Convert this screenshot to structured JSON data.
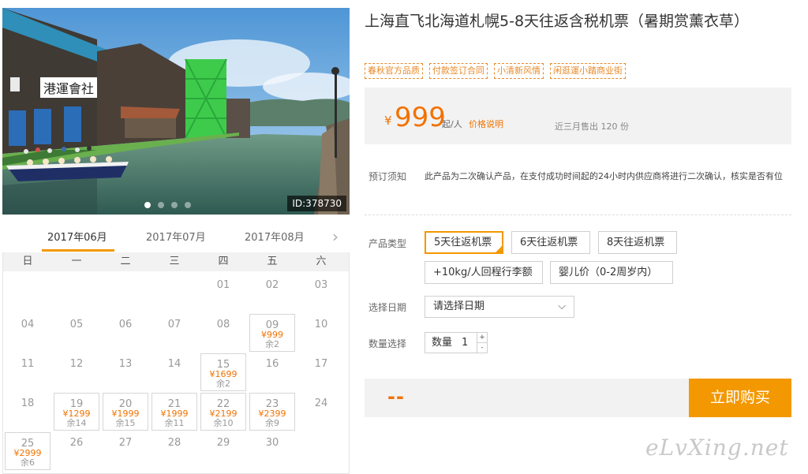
{
  "photo": {
    "id_badge": "ID:378730",
    "sign_text": "港運會社",
    "slide_count": 4,
    "active_slide": 1
  },
  "calendar": {
    "months": [
      "2017年06月",
      "2017年07月",
      "2017年08月"
    ],
    "active_month": "2017年06月",
    "next_icon": "chevron-right-icon",
    "weekdays": [
      "日",
      "一",
      "二",
      "三",
      "四",
      "五",
      "六"
    ],
    "days": [
      {
        "d": "01"
      },
      {
        "d": "02"
      },
      {
        "d": "03"
      },
      {
        "d": "04"
      },
      {
        "d": "05"
      },
      {
        "d": "06"
      },
      {
        "d": "07"
      },
      {
        "d": "08"
      },
      {
        "d": "09",
        "price": "¥999",
        "remain": "余2"
      },
      {
        "d": "10"
      },
      {
        "d": "11"
      },
      {
        "d": "12"
      },
      {
        "d": "13"
      },
      {
        "d": "14"
      },
      {
        "d": "15",
        "price": "¥1699",
        "remain": "余2"
      },
      {
        "d": "16"
      },
      {
        "d": "17"
      },
      {
        "d": "18"
      },
      {
        "d": "19",
        "price": "¥1299",
        "remain": "余14"
      },
      {
        "d": "20",
        "price": "¥1999",
        "remain": "余15"
      },
      {
        "d": "21",
        "price": "¥1999",
        "remain": "余11"
      },
      {
        "d": "22",
        "price": "¥2199",
        "remain": "余10"
      },
      {
        "d": "23",
        "price": "¥2399",
        "remain": "余9"
      },
      {
        "d": "24"
      },
      {
        "d": "25",
        "price": "¥2999",
        "remain": "余6"
      },
      {
        "d": "26"
      },
      {
        "d": "27"
      },
      {
        "d": "28"
      },
      {
        "d": "29"
      },
      {
        "d": "30"
      }
    ],
    "first_weekday_index": 4
  },
  "product": {
    "title": "上海直飞北海道札幌5-8天往返含税机票（暑期赏薰衣草）",
    "tags": [
      "春秋官方品质",
      "付款签订合同",
      "小清新风情",
      "闲逛運小踏商业街"
    ],
    "currency": "¥",
    "price": "999",
    "price_unit": "起/人",
    "price_link": "价格说明",
    "sold": "近三月售出 120 份",
    "notice_label": "预订须知",
    "notice_text": "此产品为二次确认产品，在支付成功时间起的24小时内供应商将进行二次确认，核实是否有位",
    "type_label": "产品类型",
    "types": [
      "5天往返机票",
      "6天往返机票",
      "8天往返机票",
      "+10kg/人回程行李额",
      "婴儿价（0-2周岁内）"
    ],
    "selected_type": "5天往返机票",
    "date_label": "选择日期",
    "date_placeholder": "请选择日期",
    "qty_label": "数量选择",
    "qty_prefix": "数量",
    "qty_value": "1",
    "qty_plus": "+",
    "qty_minus": "-",
    "total": "--",
    "buy_label": "立即购买"
  },
  "watermark": "eLvXing.net",
  "colors": {
    "accent": "#f39800",
    "price": "#f27200"
  }
}
